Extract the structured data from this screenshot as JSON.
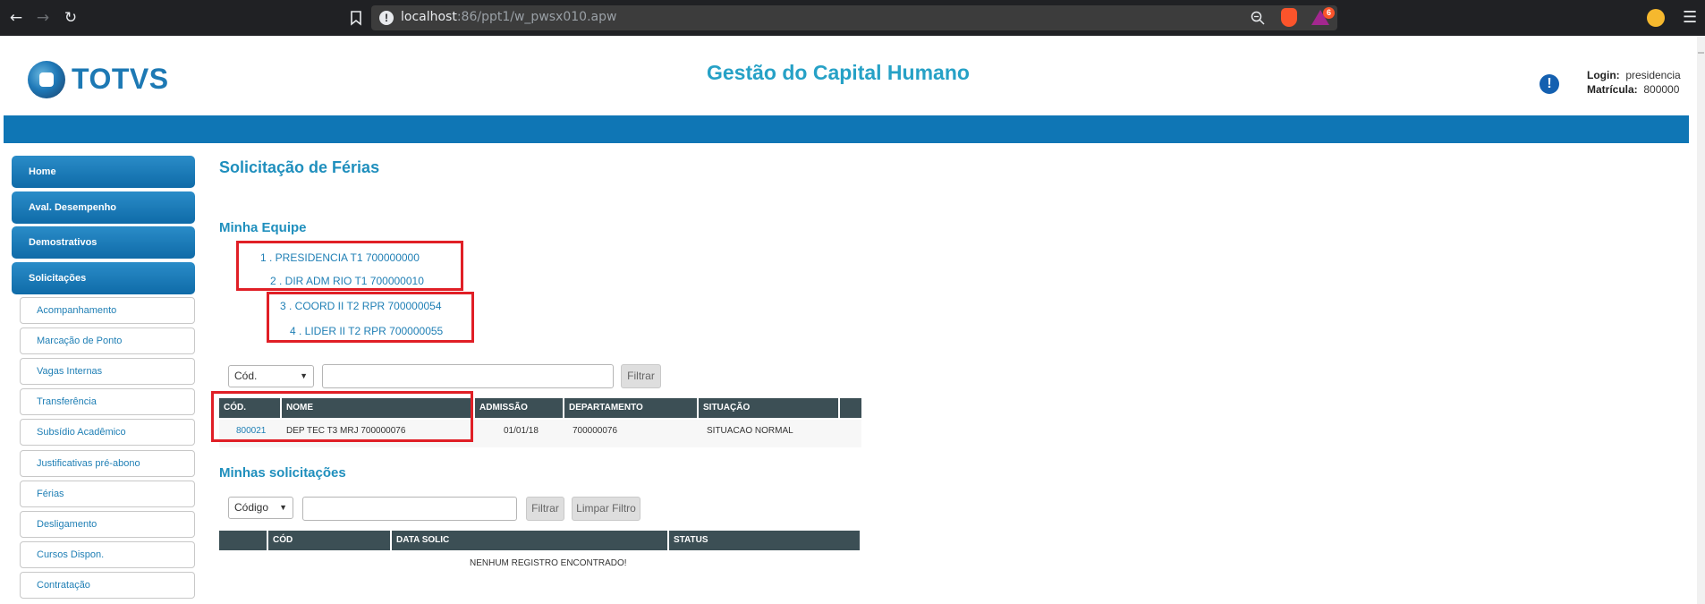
{
  "browser": {
    "url_host": "localhost",
    "url_path": ":86/ppt1/w_pwsx010.apw",
    "back_icon": "back-icon",
    "forward_icon": "forward-icon",
    "reload_icon": "reload-icon",
    "rewards_badge": "6"
  },
  "header": {
    "logo_text": "TOTVS",
    "app_title": "Gestão do Capital Humano",
    "login_label": "Login:",
    "login_value": "presidencia",
    "matricula_label": "Matrícula:",
    "matricula_value": "800000"
  },
  "sidebar": {
    "main_items": [
      {
        "label": "Home"
      },
      {
        "label": "Aval. Desempenho"
      },
      {
        "label": "Demostrativos"
      },
      {
        "label": "Solicitações"
      }
    ],
    "sub_items": [
      {
        "label": "Acompanhamento"
      },
      {
        "label": "Marcação de Ponto"
      },
      {
        "label": "Vagas Internas"
      },
      {
        "label": "Transferência"
      },
      {
        "label": "Subsídio Acadêmico"
      },
      {
        "label": "Justificativas pré-abono"
      },
      {
        "label": "Férias"
      },
      {
        "label": "Desligamento"
      },
      {
        "label": "Cursos Dispon."
      },
      {
        "label": "Contratação"
      }
    ]
  },
  "main": {
    "page_title": "Solicitação de Férias",
    "team_title": "Minha Equipe",
    "team": [
      {
        "label": "1 . PRESIDENCIA T1 700000000"
      },
      {
        "label": "2 . DIR ADM RIO T1 700000010"
      },
      {
        "label": "3 . COORD II T2 RPR 700000054"
      },
      {
        "label": "4 . LIDER II T2 RPR 700000055"
      }
    ],
    "filter1": {
      "select_value": "Cód.",
      "input_value": "",
      "button_label": "Filtrar"
    },
    "team_table": {
      "headers": [
        "CÓD.",
        "NOME",
        "ADMISSÃO",
        "DEPARTAMENTO",
        "SITUAÇÃO"
      ],
      "rows": [
        [
          "800021",
          "DEP TEC T3 MRJ 700000076",
          "01/01/18",
          "700000076",
          "SITUACAO NORMAL"
        ]
      ]
    },
    "requests_title": "Minhas solicitações",
    "filter2": {
      "select_value": "Código",
      "input_value": "",
      "filter_label": "Filtrar",
      "clear_label": "Limpar Filtro"
    },
    "requests_table": {
      "headers": [
        "",
        "CÓD",
        "DATA SOLIC",
        "STATUS"
      ],
      "empty_message": "NENHUM REGISTRO ENCONTRADO!"
    }
  }
}
